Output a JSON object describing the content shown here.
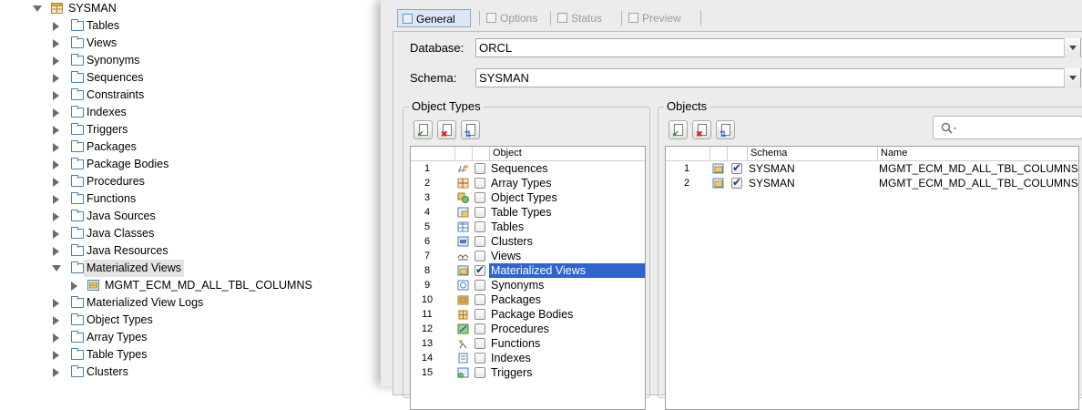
{
  "tree": {
    "root": "SYSMAN",
    "items": [
      {
        "label": "Tables",
        "expanded": false
      },
      {
        "label": "Views",
        "expanded": false
      },
      {
        "label": "Synonyms",
        "expanded": false
      },
      {
        "label": "Sequences",
        "expanded": false
      },
      {
        "label": "Constraints",
        "expanded": false
      },
      {
        "label": "Indexes",
        "expanded": false
      },
      {
        "label": "Triggers",
        "expanded": false
      },
      {
        "label": "Packages",
        "expanded": false
      },
      {
        "label": "Package Bodies",
        "expanded": false
      },
      {
        "label": "Procedures",
        "expanded": false
      },
      {
        "label": "Functions",
        "expanded": false
      },
      {
        "label": "Java Sources",
        "expanded": false
      },
      {
        "label": "Java Classes",
        "expanded": false
      },
      {
        "label": "Java Resources",
        "expanded": false
      },
      {
        "label": "Materialized Views",
        "expanded": true,
        "selected": true
      },
      {
        "label": "MGMT_ECM_MD_ALL_TBL_COLUMNS",
        "child": true
      },
      {
        "label": "Materialized View Logs",
        "expanded": false
      },
      {
        "label": "Object Types",
        "expanded": false
      },
      {
        "label": "Array Types",
        "expanded": false
      },
      {
        "label": "Table Types",
        "expanded": false
      },
      {
        "label": "Clusters",
        "expanded": false
      }
    ]
  },
  "dialog": {
    "tabs": [
      {
        "label": "General",
        "active": true
      },
      {
        "label": "Options",
        "active": false
      },
      {
        "label": "Status",
        "active": false
      },
      {
        "label": "Preview",
        "active": false
      }
    ],
    "database_label": "Database:",
    "database_value": "ORCL",
    "schema_label": "Schema:",
    "schema_value": "SYSMAN",
    "object_types": {
      "title": "Object Types",
      "column_header": "Object",
      "rows": [
        {
          "n": "1",
          "label": "Sequences",
          "checked": false
        },
        {
          "n": "2",
          "label": "Array Types",
          "checked": false
        },
        {
          "n": "3",
          "label": "Object Types",
          "checked": false
        },
        {
          "n": "4",
          "label": "Table Types",
          "checked": false
        },
        {
          "n": "5",
          "label": "Tables",
          "checked": false
        },
        {
          "n": "6",
          "label": "Clusters",
          "checked": false
        },
        {
          "n": "7",
          "label": "Views",
          "checked": false
        },
        {
          "n": "8",
          "label": "Materialized Views",
          "checked": true,
          "selected": true
        },
        {
          "n": "9",
          "label": "Synonyms",
          "checked": false
        },
        {
          "n": "10",
          "label": "Packages",
          "checked": false
        },
        {
          "n": "11",
          "label": "Package Bodies",
          "checked": false
        },
        {
          "n": "12",
          "label": "Procedures",
          "checked": false
        },
        {
          "n": "13",
          "label": "Functions",
          "checked": false
        },
        {
          "n": "14",
          "label": "Indexes",
          "checked": false
        },
        {
          "n": "15",
          "label": "Triggers",
          "checked": false
        }
      ]
    },
    "objects": {
      "title": "Objects",
      "headers": {
        "schema": "Schema",
        "name": "Name"
      },
      "rows": [
        {
          "n": "1",
          "schema": "SYSMAN",
          "name": "MGMT_ECM_MD_ALL_TBL_COLUMNS",
          "checked": true
        },
        {
          "n": "2",
          "schema": "SYSMAN",
          "name": "MGMT_ECM_MD_ALL_TBL_COLUMNS",
          "checked": true
        }
      ]
    },
    "colors": {
      "selection": "#2f64d0",
      "tab_active": "#dbe7f5"
    }
  }
}
